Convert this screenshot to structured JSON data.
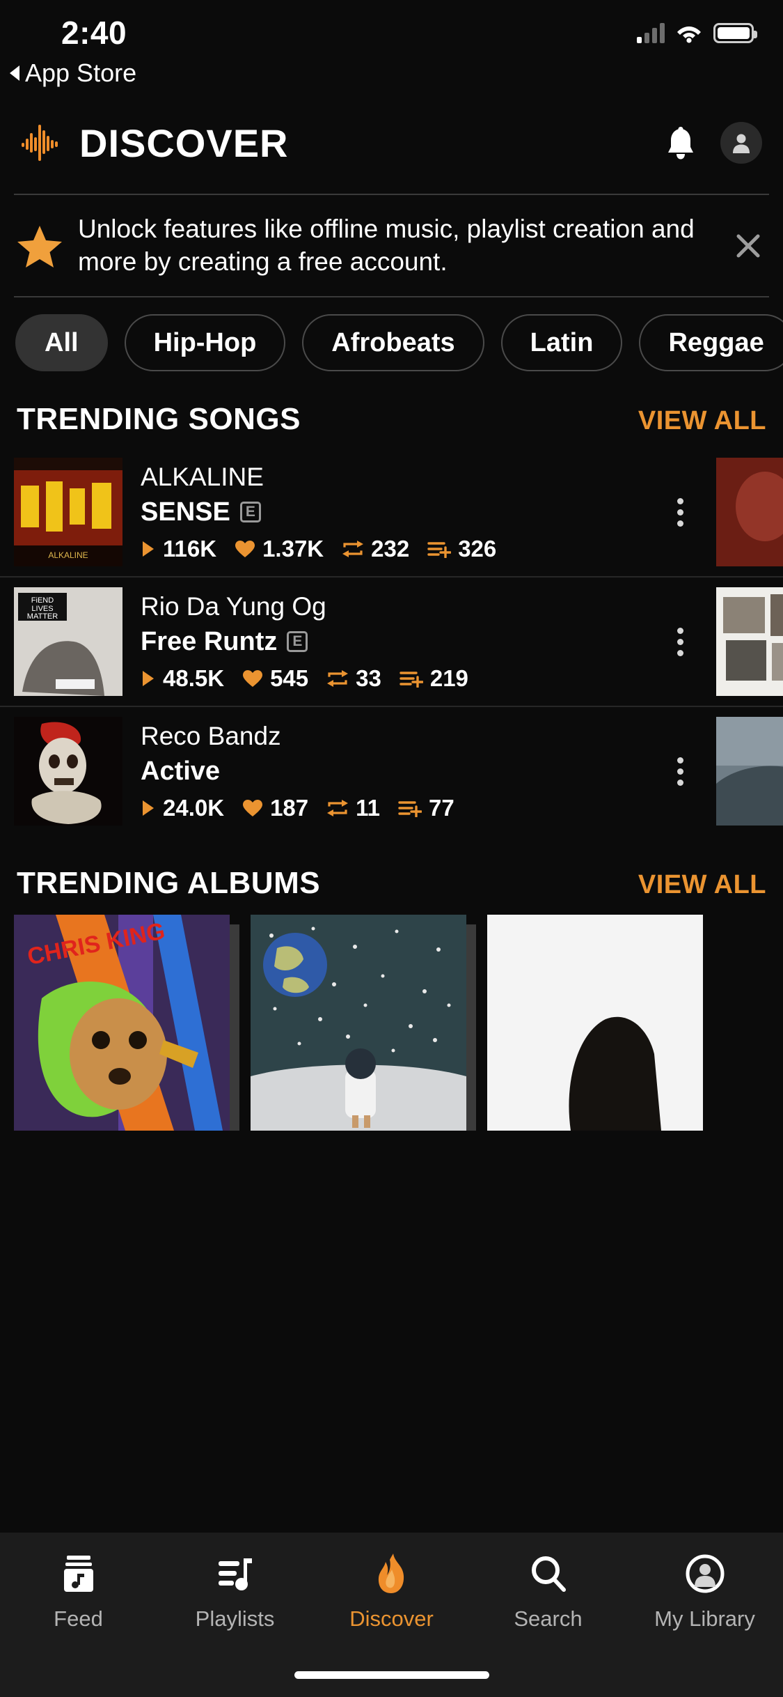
{
  "status_bar": {
    "time": "2:40",
    "back_label": "App Store",
    "signal_icon": "cellular-bars-icon",
    "wifi_icon": "wifi-icon",
    "battery_icon": "battery-icon"
  },
  "header": {
    "title": "DISCOVER",
    "logo_icon": "waveform-logo-icon",
    "notifications_icon": "bell-icon",
    "profile_icon": "account-avatar-icon",
    "accent_color": "#eb9431"
  },
  "banner": {
    "star_icon": "star-icon",
    "message": "Unlock features like offline music, playlist creation and more by creating a free account.",
    "close_icon": "close-icon"
  },
  "genre_chips": [
    {
      "label": "All",
      "active": true
    },
    {
      "label": "Hip-Hop",
      "active": false
    },
    {
      "label": "Afrobeats",
      "active": false
    },
    {
      "label": "Latin",
      "active": false
    },
    {
      "label": "Reggae",
      "active": false
    }
  ],
  "trending_songs": {
    "section_title": "TRENDING SONGS",
    "view_all": "VIEW ALL",
    "rows": [
      {
        "artist": "ALKALINE",
        "title": "SENSE",
        "explicit": "E",
        "plays": "116K",
        "likes": "1.37K",
        "reposts": "232",
        "playlist_adds": "326",
        "menu_icon": "kebab-menu-icon"
      },
      {
        "artist": "Rio Da Yung Og",
        "title": "Free Runtz",
        "explicit": "E",
        "plays": "48.5K",
        "likes": "545",
        "reposts": "33",
        "playlist_adds": "219",
        "menu_icon": "kebab-menu-icon"
      },
      {
        "artist": "Reco Bandz",
        "title": "Active",
        "explicit": "",
        "plays": "24.0K",
        "likes": "187",
        "reposts": "11",
        "playlist_adds": "77",
        "menu_icon": "kebab-menu-icon"
      }
    ]
  },
  "trending_albums": {
    "section_title": "TRENDING ALBUMS",
    "view_all": "VIEW ALL",
    "items": [
      {
        "cover_text": "CHRIS KING"
      },
      {
        "cover_text": ""
      },
      {
        "cover_text": ""
      }
    ]
  },
  "tab_bar": {
    "items": [
      {
        "label": "Feed",
        "icon": "feed-music-icon",
        "active": false
      },
      {
        "label": "Playlists",
        "icon": "playlist-note-icon",
        "active": false
      },
      {
        "label": "Discover",
        "icon": "flame-icon",
        "active": true
      },
      {
        "label": "Search",
        "icon": "search-icon",
        "active": false
      },
      {
        "label": "My Library",
        "icon": "library-account-icon",
        "active": false
      }
    ]
  }
}
